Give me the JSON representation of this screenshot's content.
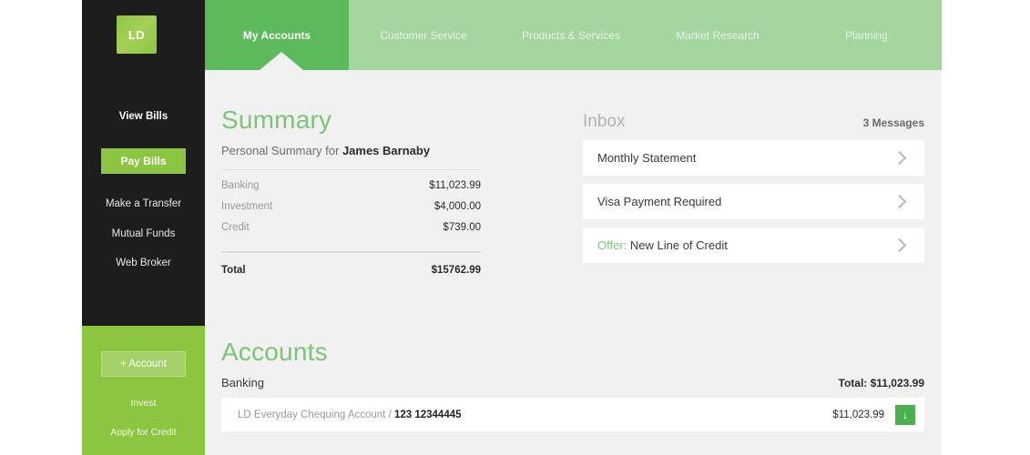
{
  "brand": {
    "logo_text": "LD",
    "accent": "#8cc540",
    "header_green": "#5cba5c",
    "light_green": "#a5d6a0"
  },
  "sidebar": {
    "links": [
      {
        "label": "View Bills"
      },
      {
        "label": "Pay Bills"
      },
      {
        "label": "Make a Transfer"
      },
      {
        "label": "Mutual Funds"
      },
      {
        "label": "Web Broker"
      }
    ],
    "green_panel": {
      "account_button": "+ Account",
      "links": [
        {
          "label": "Invest"
        },
        {
          "label": "Apply for Credit"
        }
      ]
    }
  },
  "nav": {
    "tabs": [
      {
        "label": "My Accounts",
        "active": true
      },
      {
        "label": "Customer Service",
        "active": false
      },
      {
        "label": "Products & Services",
        "active": false
      },
      {
        "label": "Market Research",
        "active": false
      },
      {
        "label": "Planning",
        "active": false
      }
    ]
  },
  "summary": {
    "title": "Summary",
    "subtitle_prefix": "Personal Summary for ",
    "customer_name": "James Barnaby",
    "rows": [
      {
        "label": "Banking",
        "value": "$11,023.99"
      },
      {
        "label": "Investment",
        "value": "$4,000.00"
      },
      {
        "label": "Credit",
        "value": "$739.00"
      }
    ],
    "total_label": "Total",
    "total_value": "$15762.99"
  },
  "inbox": {
    "title": "Inbox",
    "count_label": "3 Messages",
    "messages": [
      {
        "prefix": "",
        "subject": "Monthly Statement"
      },
      {
        "prefix": "",
        "subject": "Visa Payment Required"
      },
      {
        "prefix": "Offer:",
        "subject": " New Line of Credit"
      }
    ]
  },
  "accounts": {
    "title": "Accounts",
    "group_label": "Banking",
    "group_total": "Total: $11,023.99",
    "rows": [
      {
        "name": "LD Everyday Chequing Account / ",
        "number": "123  12344445",
        "amount": "$11,023.99",
        "icon": "download-icon",
        "icon_glyph": "↓"
      }
    ]
  }
}
